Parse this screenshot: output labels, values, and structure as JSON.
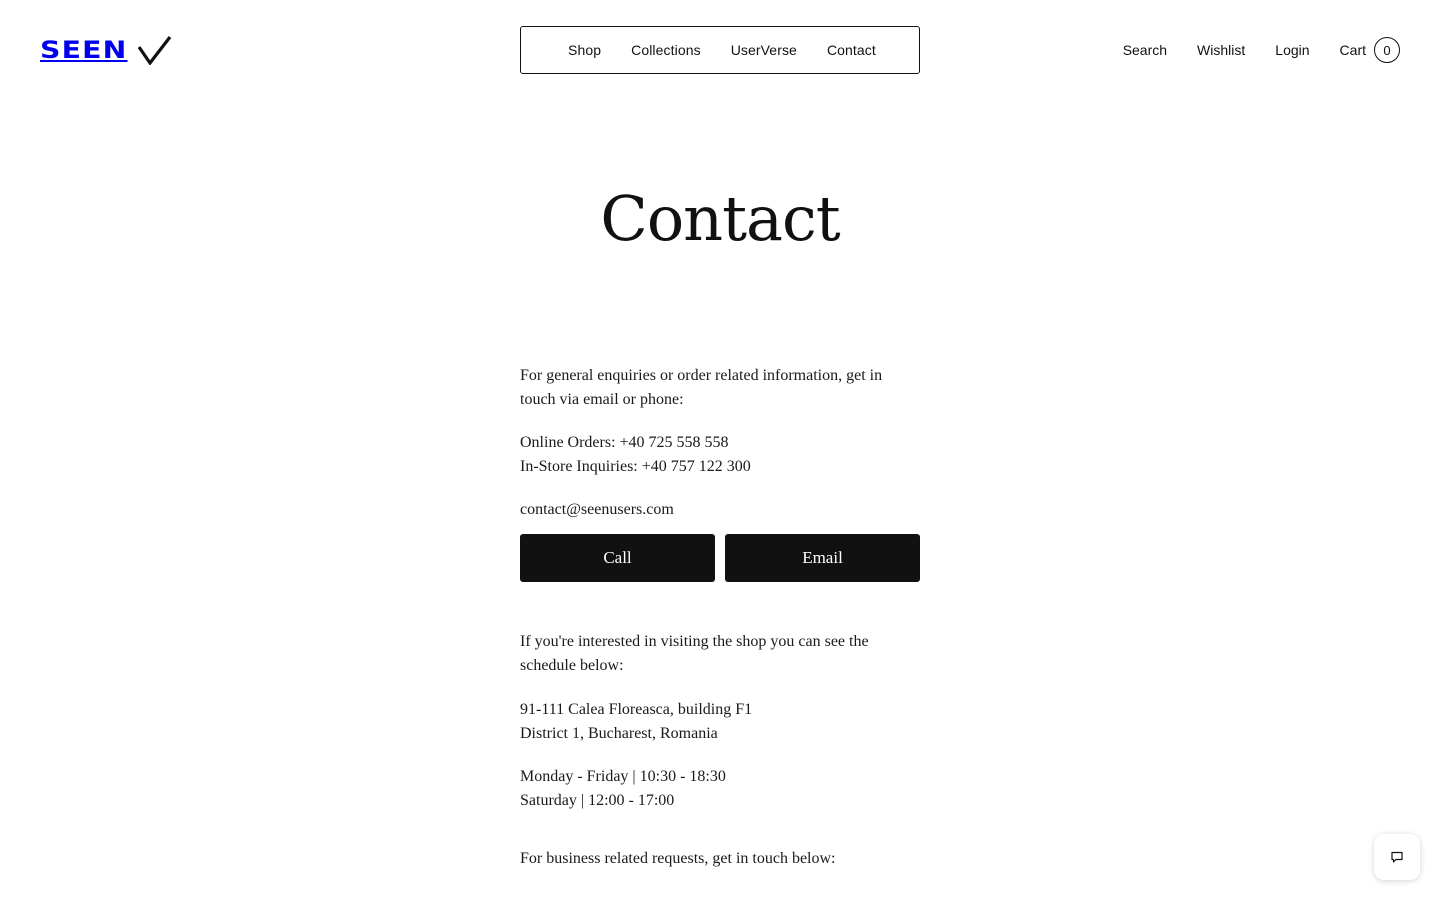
{
  "header": {
    "logo_text": "SEEN",
    "nav": [
      "Shop",
      "Collections",
      "UserVerse",
      "Contact"
    ],
    "search_label": "Search",
    "wishlist_label": "Wishlist",
    "login_label": "Login",
    "cart_label": "Cart",
    "cart_count": "0"
  },
  "page": {
    "title": "Contact"
  },
  "contact": {
    "intro": "For general enquiries or order related information, get in touch via email or phone:",
    "online_orders": "Online Orders: +40 725 558 558",
    "instore_inquiries": "In-Store Inquiries: +40 757 122 300",
    "email": "contact@seenusers.com",
    "call_button": "Call",
    "email_button": "Email",
    "visit_intro": "If you're interested in visiting the shop you can see the schedule below:",
    "address_line1": "91-111 Calea Floreasca, building F1",
    "address_line2": "District 1, Bucharest, Romania",
    "hours_weekday": "Monday - Friday | 10:30 - 18:30",
    "hours_saturday": "Saturday | 12:00 - 17:00",
    "business_intro": "For business related requests, get in touch below:"
  },
  "icons": {
    "logo_check": "checkmark-icon",
    "chat": "chat-bubble-icon"
  }
}
